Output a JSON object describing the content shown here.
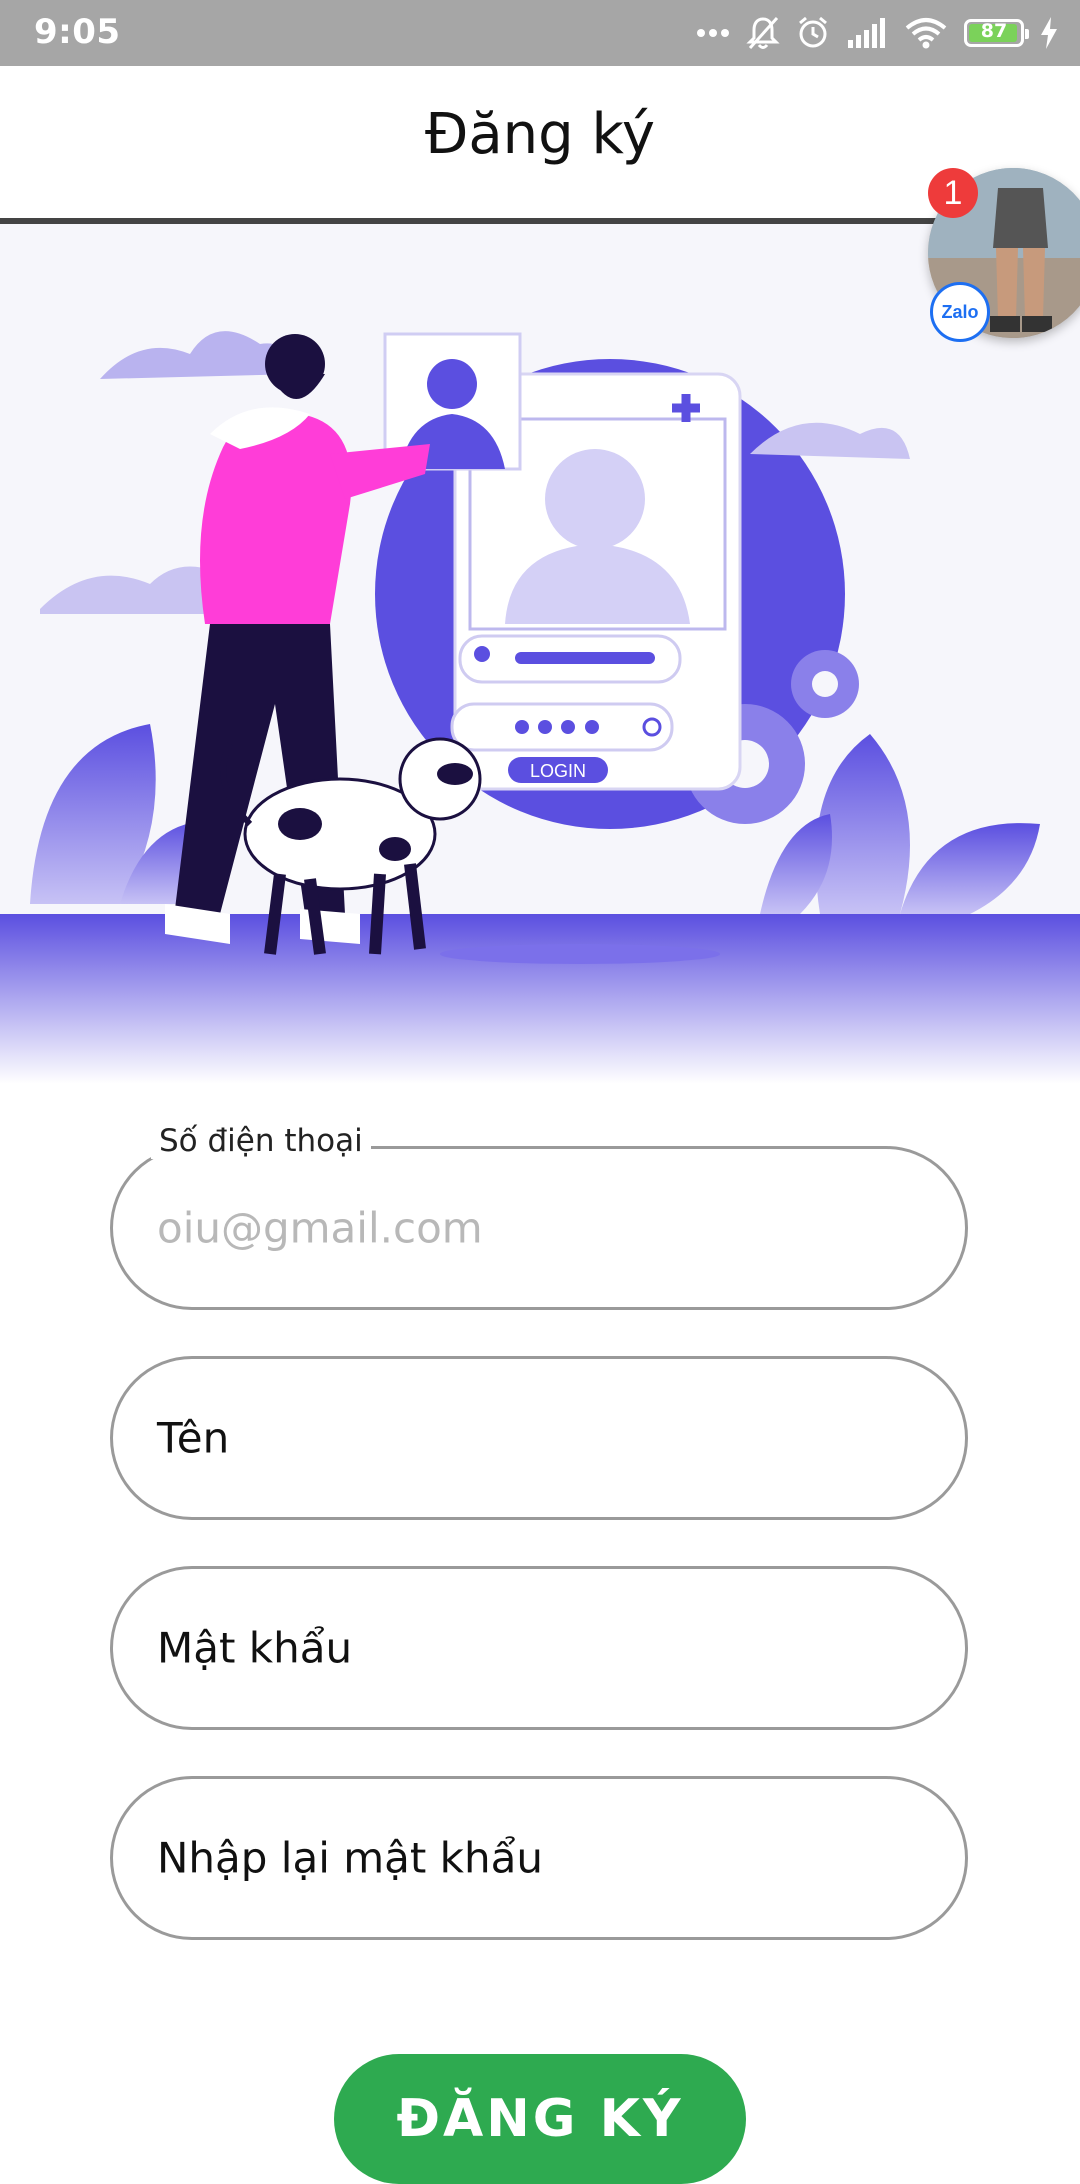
{
  "status_bar": {
    "time": "9:05",
    "battery_level": "87",
    "icons": [
      "more-dots-icon",
      "silent-bell-icon",
      "alarm-icon",
      "signal-icon",
      "wifi-icon",
      "battery-icon",
      "charging-icon"
    ]
  },
  "header": {
    "title": "Đăng ký"
  },
  "chat_head": {
    "badge_count": "1",
    "app_label": "Zalo"
  },
  "hero": {
    "login_label": "LOGIN"
  },
  "form": {
    "phone": {
      "label": "Số điện thoại",
      "placeholder": "oiu@gmail.com"
    },
    "name": {
      "placeholder": "Tên"
    },
    "password": {
      "placeholder": "Mật khẩu"
    },
    "confirm_password": {
      "placeholder": "Nhập lại mật khẩu"
    },
    "submit_label": "ĐĂNG KÝ"
  },
  "colors": {
    "accent": "#5b4fe0",
    "button": "#2eaa50",
    "status_bar": "#a6a6a6"
  }
}
